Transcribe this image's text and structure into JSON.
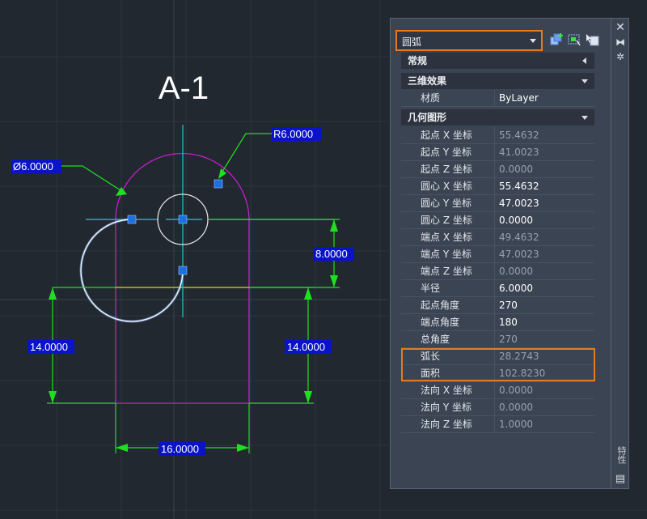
{
  "drawing": {
    "title": "A-1",
    "dims": {
      "dia": "Ø6.0000",
      "radius": "R6.0000",
      "vert_top": "8.0000",
      "left_height": "14.0000",
      "right_height": "14.0000",
      "width": "16.0000"
    },
    "colors": {
      "background": "#212830",
      "outline": "#c81ecf",
      "dimension": "#1ee11e",
      "centerline": "#1ec8d8",
      "selected_arc": "#8fb8ff",
      "grip": "#1e6fe0",
      "hidden_line": "#d8d81e"
    }
  },
  "palette": {
    "selector_value": "圆弧",
    "side_title": "特性",
    "categories": {
      "general": "常规",
      "threed": "三维效果",
      "geometry": "几何图形"
    },
    "threed_rows": [
      {
        "label": "材质",
        "value": "ByLayer",
        "readonly": false
      }
    ],
    "geometry_rows": [
      {
        "label": "起点 X 坐标",
        "value": "55.4632",
        "readonly": true
      },
      {
        "label": "起点 Y 坐标",
        "value": "41.0023",
        "readonly": true
      },
      {
        "label": "起点 Z 坐标",
        "value": "0.0000",
        "readonly": true
      },
      {
        "label": "圆心 X 坐标",
        "value": "55.4632",
        "readonly": false
      },
      {
        "label": "圆心 Y 坐标",
        "value": "47.0023",
        "readonly": false
      },
      {
        "label": "圆心 Z 坐标",
        "value": "0.0000",
        "readonly": false
      },
      {
        "label": "端点 X 坐标",
        "value": "49.4632",
        "readonly": true
      },
      {
        "label": "端点 Y 坐标",
        "value": "47.0023",
        "readonly": true
      },
      {
        "label": "端点 Z 坐标",
        "value": "0.0000",
        "readonly": true
      },
      {
        "label": "半径",
        "value": "6.0000",
        "readonly": false
      },
      {
        "label": "起点角度",
        "value": "270",
        "readonly": false
      },
      {
        "label": "端点角度",
        "value": "180",
        "readonly": false
      },
      {
        "label": "总角度",
        "value": "270",
        "readonly": true
      },
      {
        "label": "弧长",
        "value": "28.2743",
        "readonly": true
      },
      {
        "label": "面积",
        "value": "102.8230",
        "readonly": true
      },
      {
        "label": "法向 X 坐标",
        "value": "0.0000",
        "readonly": true
      },
      {
        "label": "法向 Y 坐标",
        "value": "0.0000",
        "readonly": true
      },
      {
        "label": "法向 Z 坐标",
        "value": "1.0000",
        "readonly": true
      }
    ],
    "icons": [
      "add-to-selection-icon",
      "quick-select-icon",
      "toggle-pickadd-icon"
    ],
    "accent": "#e87a1e"
  }
}
